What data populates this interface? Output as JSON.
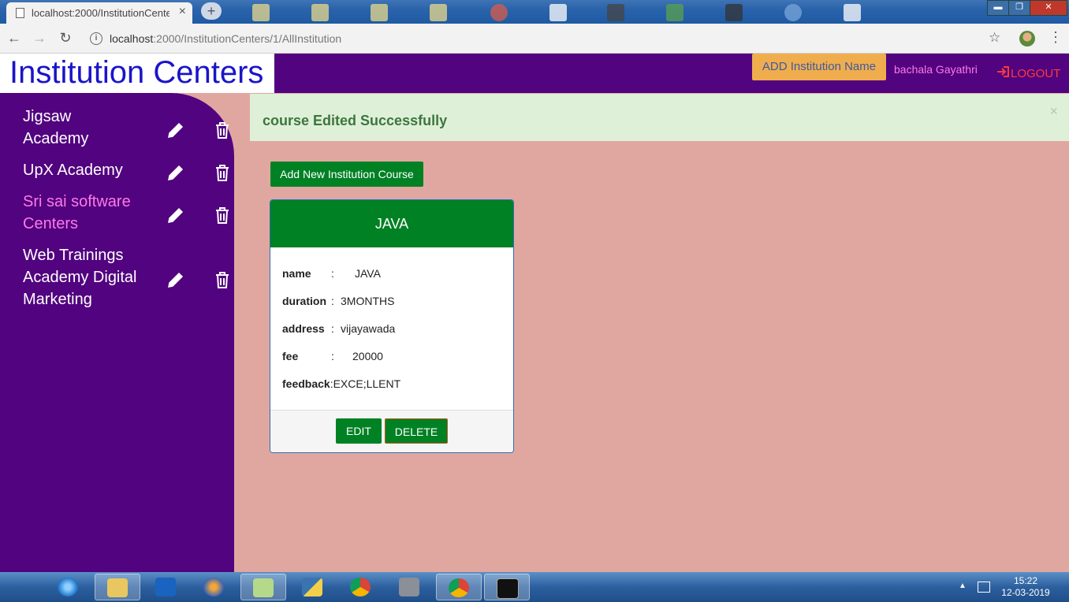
{
  "browser": {
    "tab_title": "localhost:2000/InstitutionCenters",
    "tab_close": "×",
    "new_tab": "+",
    "url_host": "localhost",
    "url_path": ":2000/InstitutionCenters/1/AllInstitution",
    "window_controls": {
      "minimize": "▬",
      "restore": "❐",
      "close": "✕"
    }
  },
  "header": {
    "brand": "Institution Centers",
    "add_institution_label": "ADD Institution Name",
    "user_name": "bachala Gayathri",
    "logout_label": "LOGOUT"
  },
  "sidebar": {
    "items": [
      {
        "label_lines": [
          "Jigsaw",
          "Academy"
        ],
        "active": false
      },
      {
        "label_lines": [
          "UpX Academy"
        ],
        "active": false
      },
      {
        "label_lines": [
          "Sri sai software",
          "Centers"
        ],
        "active": true
      },
      {
        "label_lines": [
          "Web Trainings",
          "Academy Digital",
          "Marketing"
        ],
        "active": false
      }
    ]
  },
  "alert": {
    "message": "course Edited Successfully",
    "close": "×"
  },
  "main": {
    "add_course_label": "Add New Institution Course",
    "course": {
      "title": "JAVA",
      "fields": [
        {
          "label": "name",
          "sep": ":",
          "value": "JAVA"
        },
        {
          "label": "duration",
          "sep": ":",
          "value": "3MONTHS"
        },
        {
          "label": "address",
          "sep": ":",
          "value": "vijayawada"
        },
        {
          "label": "fee",
          "sep": ":",
          "value": "20000"
        },
        {
          "label": "feedback",
          "sep": ":",
          "value": "EXCE;LLENT"
        }
      ],
      "edit_label": "EDIT",
      "delete_label": "DELETE"
    }
  },
  "taskbar": {
    "time": "15:22",
    "date": "12-03-2019",
    "tray_arrow": "▲"
  },
  "colors": {
    "header_bg": "#52037f",
    "page_bg": "#e0a7a0",
    "primary_green": "#008124",
    "brand_text": "#1a14c9",
    "active_item": "#ff79e9",
    "add_button": "#f0ad4e",
    "alert_bg": "#dff0d8",
    "alert_text": "#3c763d"
  }
}
